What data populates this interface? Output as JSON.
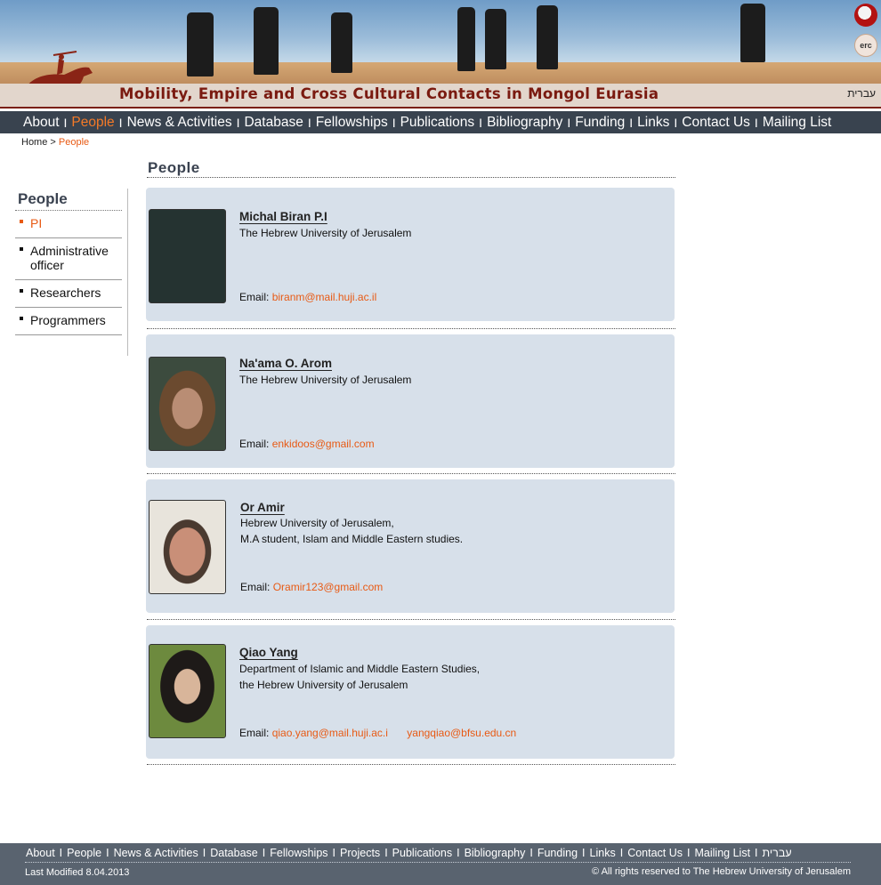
{
  "header": {
    "site_title": "Mobility, Empire and Cross Cultural Contacts in Mongol Eurasia",
    "hebrew_link": "עברית",
    "badge_2_text": "erc"
  },
  "nav": {
    "items": [
      {
        "label": "About"
      },
      {
        "label": "People",
        "active": true
      },
      {
        "label": "News & Activities"
      },
      {
        "label": "Database"
      },
      {
        "label": "Fellowships"
      },
      {
        "label": "Publications"
      },
      {
        "label": "Bibliography"
      },
      {
        "label": "Funding"
      },
      {
        "label": "Links"
      },
      {
        "label": "Contact Us"
      },
      {
        "label": "Mailing List"
      }
    ],
    "separator": "I"
  },
  "breadcrumb": {
    "home": "Home",
    "separator": ">",
    "current": "People"
  },
  "sidebar": {
    "title": "People",
    "items": [
      {
        "label": "PI",
        "active": true
      },
      {
        "label": "Administrative officer"
      },
      {
        "label": "Researchers"
      },
      {
        "label": "Programmers"
      }
    ]
  },
  "main": {
    "title": "People",
    "people": [
      {
        "name": "Michal Biran P.I",
        "affiliation": [
          "The Hebrew University of Jerusalem"
        ],
        "email_label": "Email:",
        "emails": [
          "biranm@mail.huji.ac.il"
        ]
      },
      {
        "name": "Na'ama O. Arom",
        "affiliation": [
          "The Hebrew University of Jerusalem"
        ],
        "email_label": "Email:",
        "emails": [
          "enkidoos@gmail.com"
        ]
      },
      {
        "name": "Or Amir",
        "affiliation": [
          "Hebrew University of Jerusalem,",
          "M.A student, Islam and Middle Eastern studies."
        ],
        "email_label": "Email:",
        "emails": [
          "Oramir123@gmail.com"
        ]
      },
      {
        "name": "Qiao Yang",
        "affiliation": [
          "Department of Islamic and Middle Eastern Studies,",
          "the Hebrew University of Jerusalem"
        ],
        "email_label": "Email:",
        "emails": [
          "qiao.yang@mail.huji.ac.i",
          "yangqiao@bfsu.edu.cn"
        ]
      }
    ]
  },
  "footer": {
    "items": [
      "About",
      "People",
      "News & Activities",
      "Database",
      "Fellowships",
      "Projects",
      "Publications",
      "Bibliography",
      "Funding",
      "Links",
      "Contact Us",
      "Mailing List",
      "עברית"
    ],
    "separator": "I",
    "last_modified": "Last Modified 8.04.2013",
    "copyright": "© All rights reserved to The Hebrew University of Jerusalem"
  },
  "colors": {
    "nav_bg": "#39434f",
    "accent": "#e85a14",
    "card_bg": "#d7e0ea",
    "footer_bg": "#59636f",
    "title_red": "#7a1a10"
  }
}
